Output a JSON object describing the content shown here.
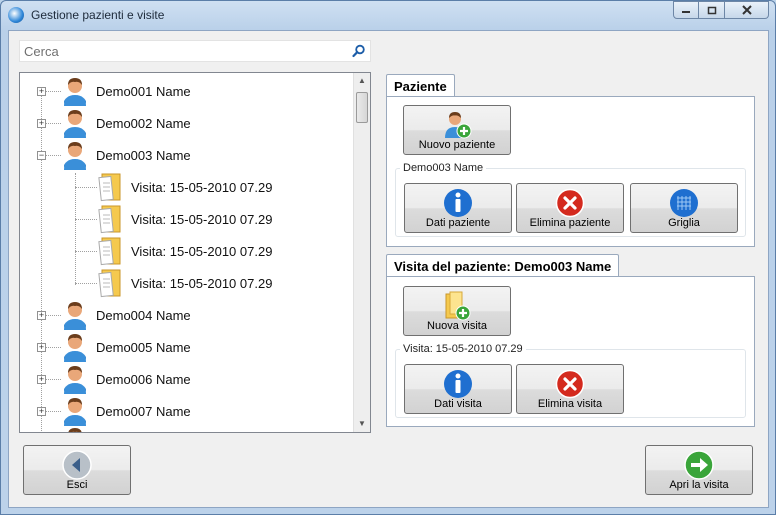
{
  "window": {
    "title": "Gestione pazienti e visite"
  },
  "search": {
    "placeholder": "Cerca",
    "value": ""
  },
  "tree": {
    "patients": [
      {
        "name": "Demo001 Name",
        "expanded": false
      },
      {
        "name": "Demo002 Name",
        "expanded": false
      },
      {
        "name": "Demo003 Name",
        "expanded": true
      },
      {
        "name": "Demo004 Name",
        "expanded": false
      },
      {
        "name": "Demo005 Name",
        "expanded": false
      },
      {
        "name": "Demo006 Name",
        "expanded": false
      },
      {
        "name": "Demo007 Name",
        "expanded": false
      }
    ],
    "visits": [
      "Visita: 15-05-2010 07.29",
      "Visita: 15-05-2010 07.29",
      "Visita: 15-05-2010 07.29",
      "Visita: 15-05-2010 07.29"
    ]
  },
  "patient_panel": {
    "tab": "Paziente",
    "new_patient": "Nuovo paziente",
    "selected_label": "Demo003 Name",
    "data_patient": "Dati paziente",
    "delete_patient": "Elimina paziente",
    "grid": "Griglia"
  },
  "visit_panel": {
    "tab": "Visita del paziente: Demo003 Name",
    "new_visit": "Nuova visita",
    "selected_label": "Visita: 15-05-2010 07.29",
    "data_visit": "Dati visita",
    "delete_visit": "Elimina visita"
  },
  "footer": {
    "exit": "Esci",
    "open_visit": "Apri la visita"
  },
  "colors": {
    "accent_blue": "#1f6fd0",
    "delete_red": "#d42a1e",
    "add_green": "#3aa53a"
  }
}
